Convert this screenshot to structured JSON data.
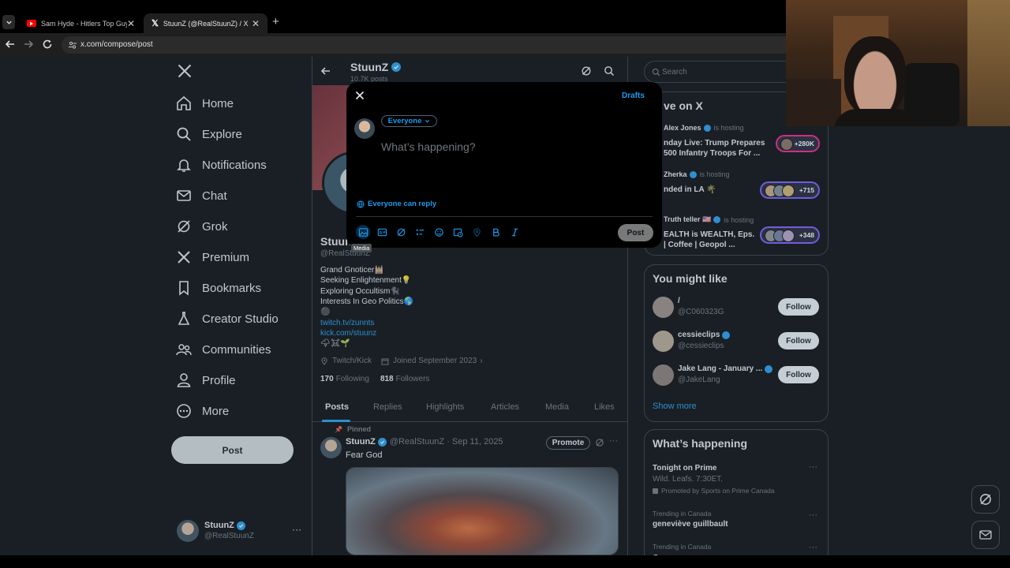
{
  "browser": {
    "tabs": [
      {
        "title": "Sam Hyde - Hitlers Top Guy - Y",
        "favicon": "youtube-icon"
      },
      {
        "title": "StuunZ (@RealStuunZ) / X",
        "favicon": "x-logo-icon"
      }
    ],
    "url": "x.com/compose/post",
    "accent_color": "#1d9bf0"
  },
  "nav": {
    "items": [
      {
        "label": "Home",
        "icon": "home-icon"
      },
      {
        "label": "Explore",
        "icon": "search-icon"
      },
      {
        "label": "Notifications",
        "icon": "bell-icon"
      },
      {
        "label": "Chat",
        "icon": "mail-icon"
      },
      {
        "label": "Grok",
        "icon": "grok-icon"
      },
      {
        "label": "Premium",
        "icon": "x-logo-icon"
      },
      {
        "label": "Bookmarks",
        "icon": "bookmark-icon"
      },
      {
        "label": "Creator Studio",
        "icon": "flask-icon"
      },
      {
        "label": "Communities",
        "icon": "people-icon"
      },
      {
        "label": "Profile",
        "icon": "user-icon"
      },
      {
        "label": "More",
        "icon": "more-circle-icon"
      }
    ],
    "post_label": "Post",
    "account": {
      "name": "StuunZ",
      "handle": "@RealStuunZ"
    }
  },
  "profile": {
    "name": "StuunZ",
    "posts_count": "10.7K posts",
    "handle": "@RealStuunZ",
    "bio": [
      "Grand Gnoticer🕍",
      "Seeking Enlightenment💡",
      "Exploring Occultism🐈‍⬛",
      "Interests In Geo Politics🌎",
      "⚫"
    ],
    "links": [
      "twitch.tv/zunnts",
      "kick.com/stuunz"
    ],
    "emoji_line": "🌩☠🌱",
    "location": "Twitch/Kick",
    "joined": "Joined September 2023",
    "following_count": "170",
    "following_label": "Following",
    "followers_count": "818",
    "followers_label": "Followers",
    "tabs": [
      "Posts",
      "Replies",
      "Highlights",
      "Articles",
      "Media",
      "Likes"
    ]
  },
  "pinned_post": {
    "pinned_label": "Pinned",
    "name": "StuunZ",
    "meta": "@RealStuunZ · Sep 11, 2025",
    "promote_label": "Promote",
    "text": "Fear God"
  },
  "search": {
    "placeholder": "Search"
  },
  "live": {
    "title": "ve on X",
    "items": [
      {
        "host": "Alex Jones",
        "status": "is hosting",
        "text": "nday Live: Trump Prepares\n500 Infantry Troops For ...",
        "count": "+280K"
      },
      {
        "host": "Zherka",
        "status": "is hosting",
        "text": "nded in LA 🌴",
        "count": "+715"
      },
      {
        "host": "Truth teller 🇺🇸",
        "status": "is hosting",
        "text": "EALTH is WEALTH, Eps.\n| Coffee | Geopol ...",
        "count": "+348"
      }
    ]
  },
  "might_like": {
    "title": "You might like",
    "follow_label": "Follow",
    "show_more": "Show more",
    "people": [
      {
        "name": "/",
        "handle": "@C060323G",
        "verified": false
      },
      {
        "name": "cessieclips",
        "handle": "@cessieclips",
        "verified": true
      },
      {
        "name": "Jake Lang - January ...",
        "handle": "@JakeLang",
        "verified": true
      }
    ]
  },
  "happening": {
    "title": "What’s happening",
    "items": [
      {
        "title": "Tonight on Prime",
        "sub": "Wild. Leafs. 7:30ET.",
        "promo": "Promoted by Sports on Prime Canada"
      },
      {
        "context": "Trending in Canada",
        "title": "geneviève guillbault"
      },
      {
        "context": "Trending in Canada",
        "title": "G"
      }
    ]
  },
  "compose": {
    "drafts_label": "Drafts",
    "audience_label": "Everyone",
    "placeholder": "What’s happening?",
    "reply_label": "Everyone can reply",
    "post_label": "Post",
    "tooltip": "Media",
    "toolbar_icons": [
      "media-icon",
      "gif-icon",
      "grok-icon",
      "poll-icon",
      "emoji-icon",
      "schedule-icon",
      "location-icon",
      "bold-icon",
      "italic-icon"
    ]
  }
}
